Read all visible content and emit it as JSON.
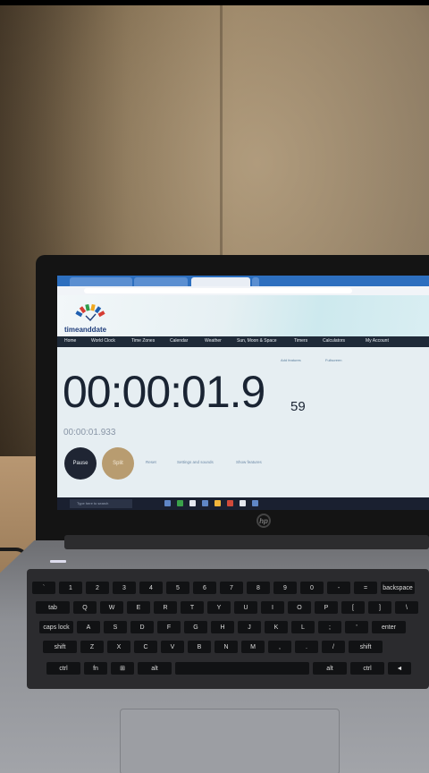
{
  "browser": {
    "tabs": [
      {
        "label": ""
      },
      {
        "label": ""
      },
      {
        "label": ""
      },
      {
        "label": ""
      }
    ]
  },
  "site": {
    "logo_text": "timeanddate",
    "logo_colors": [
      "#1f5fb0",
      "#d53c33",
      "#2e9d4a",
      "#f0a81e",
      "#1f5fb0",
      "#d53c33"
    ],
    "nav": [
      "Home",
      "World Clock",
      "Time Zones",
      "Calendar",
      "Weather",
      "Sun, Moon & Space",
      "Timers",
      "Calculators",
      "My Account"
    ]
  },
  "stopwatch": {
    "display": "00:00:01.9",
    "display_ms": "59",
    "lap_time": "00:00:01.933",
    "pause_label": "Pause",
    "split_label": "Split",
    "reset_label": "Reset",
    "settings_label": "Settings and sounds",
    "show_features_label": "Show features",
    "add_label": "Add features",
    "fullscreen_label": "Fullscreen"
  },
  "taskbar": {
    "search_placeholder": "Type here to search"
  },
  "laptop": {
    "brand": "hp",
    "keys": {
      "row1": [
        "`",
        "1",
        "2",
        "3",
        "4",
        "5",
        "6",
        "7",
        "8",
        "9",
        "0",
        "-",
        "=",
        "backspace"
      ],
      "row2": [
        "tab",
        "Q",
        "W",
        "E",
        "R",
        "T",
        "Y",
        "U",
        "I",
        "O",
        "P",
        "[",
        "]",
        "\\"
      ],
      "row3": [
        "caps lock",
        "A",
        "S",
        "D",
        "F",
        "G",
        "H",
        "J",
        "K",
        "L",
        ";",
        "'",
        "enter"
      ],
      "row4": [
        "shift",
        "Z",
        "X",
        "C",
        "V",
        "B",
        "N",
        "M",
        ",",
        ".",
        "/",
        "shift"
      ],
      "row5": [
        "ctrl",
        "fn",
        "⊞",
        "alt",
        "",
        "alt",
        "ctrl",
        "◄",
        "▼",
        "►"
      ]
    }
  }
}
